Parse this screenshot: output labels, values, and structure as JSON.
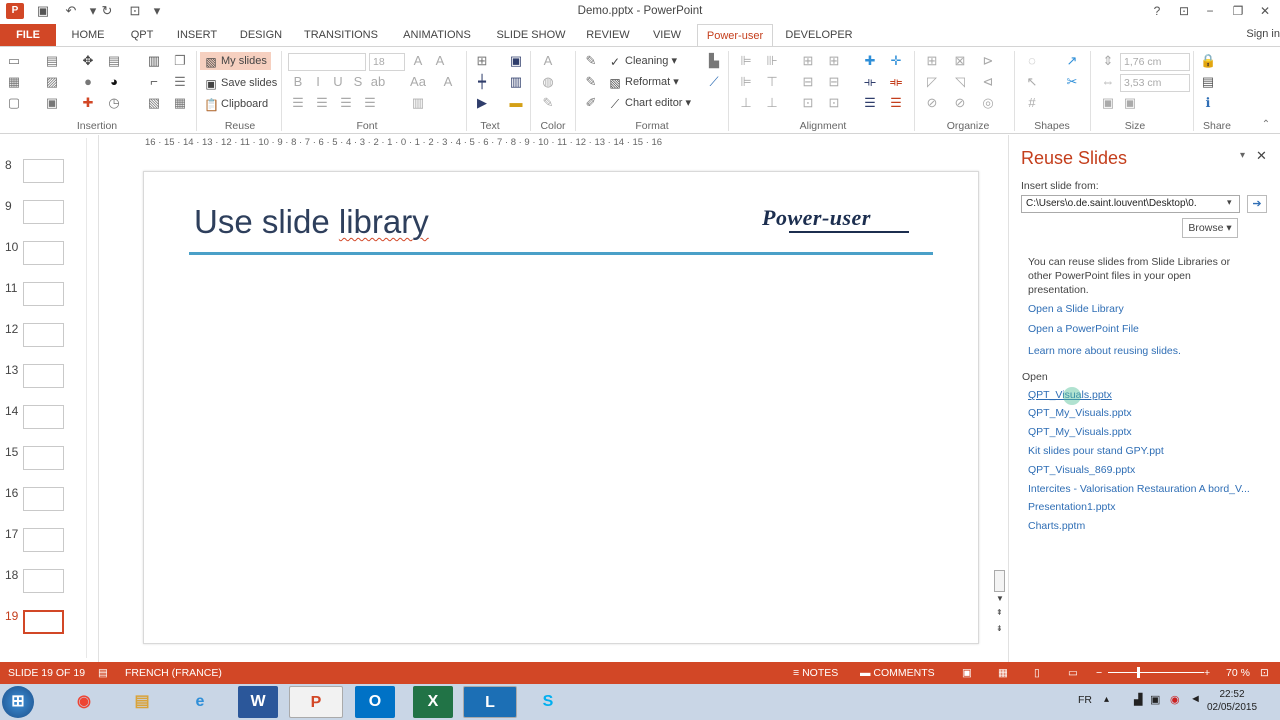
{
  "window": {
    "title": "Demo.pptx - PowerPoint",
    "signin": "Sign in"
  },
  "colors": {
    "accent": "#d24726",
    "link": "#2f6eb5",
    "slide_rule": "#4aa0c8"
  },
  "tabs": [
    "FILE",
    "HOME",
    "QPT",
    "INSERT",
    "DESIGN",
    "TRANSITIONS",
    "ANIMATIONS",
    "SLIDE SHOW",
    "REVIEW",
    "VIEW",
    "Power-user",
    "DEVELOPER"
  ],
  "active_tab": "Power-user",
  "ribbon": {
    "groups": [
      "Insertion",
      "Reuse",
      "Font",
      "Text",
      "Color",
      "Format",
      "Alignment",
      "Organize",
      "Shapes",
      "Size",
      "Share"
    ],
    "reuse": {
      "my_slides": "My slides",
      "save_slides": "Save slides",
      "clipboard": "Clipboard"
    },
    "font_size": "18",
    "format": {
      "cleaning": "Cleaning",
      "reformat": "Reformat",
      "chart_editor": "Chart editor"
    },
    "size": {
      "width": "1,76 cm",
      "height": "3,53 cm"
    }
  },
  "thumbnails": [
    "8",
    "9",
    "10",
    "11",
    "12",
    "13",
    "14",
    "15",
    "16",
    "17",
    "18",
    "19"
  ],
  "selected_slide": "19",
  "ruler": "16 · 15 · 14 · 13 · 12 · 11 · 10 · 9 · 8 · 7 · 6 · 5 · 4 · 3 · 2 · 1 · 0 · 1 · 2 · 3 · 4 · 5 · 6 · 7 · 8 · 9 · 10 · 11 · 12 · 13 · 14 · 15 · 16",
  "slide": {
    "title_a": "Use slide ",
    "title_b": "library",
    "logo": "Power-user"
  },
  "reuse_pane": {
    "title": "Reuse Slides",
    "insert_label": "Insert slide from:",
    "path": "C:\\Users\\o.de.saint.louvent\\Desktop\\0.",
    "browse": "Browse",
    "description": "You can reuse slides from Slide Libraries or other PowerPoint files in your open presentation.",
    "links": [
      "Open a Slide Library",
      "Open a PowerPoint File",
      "Learn more about reusing slides."
    ],
    "open_label": "Open",
    "recent_files": [
      "QPT_Visuals.pptx",
      "QPT_My_Visuals.pptx",
      "QPT_My_Visuals.pptx",
      "Kit slides pour stand GPY.ppt",
      "QPT_Visuals_869.pptx",
      "Intercites - Valorisation Restauration A bord_V...",
      "Presentation1.pptx",
      "Charts.pptm"
    ]
  },
  "status": {
    "slide_count": "SLIDE 19 OF 19",
    "language": "FRENCH (FRANCE)",
    "notes": "NOTES",
    "comments": "COMMENTS",
    "zoom": "70 %"
  },
  "taskbar": {
    "lang": "FR",
    "time": "22:52",
    "date": "02/05/2015",
    "apps": [
      "chrome",
      "explorer",
      "ie",
      "word",
      "powerpoint",
      "outlook",
      "excel",
      "lync",
      "skype"
    ]
  }
}
